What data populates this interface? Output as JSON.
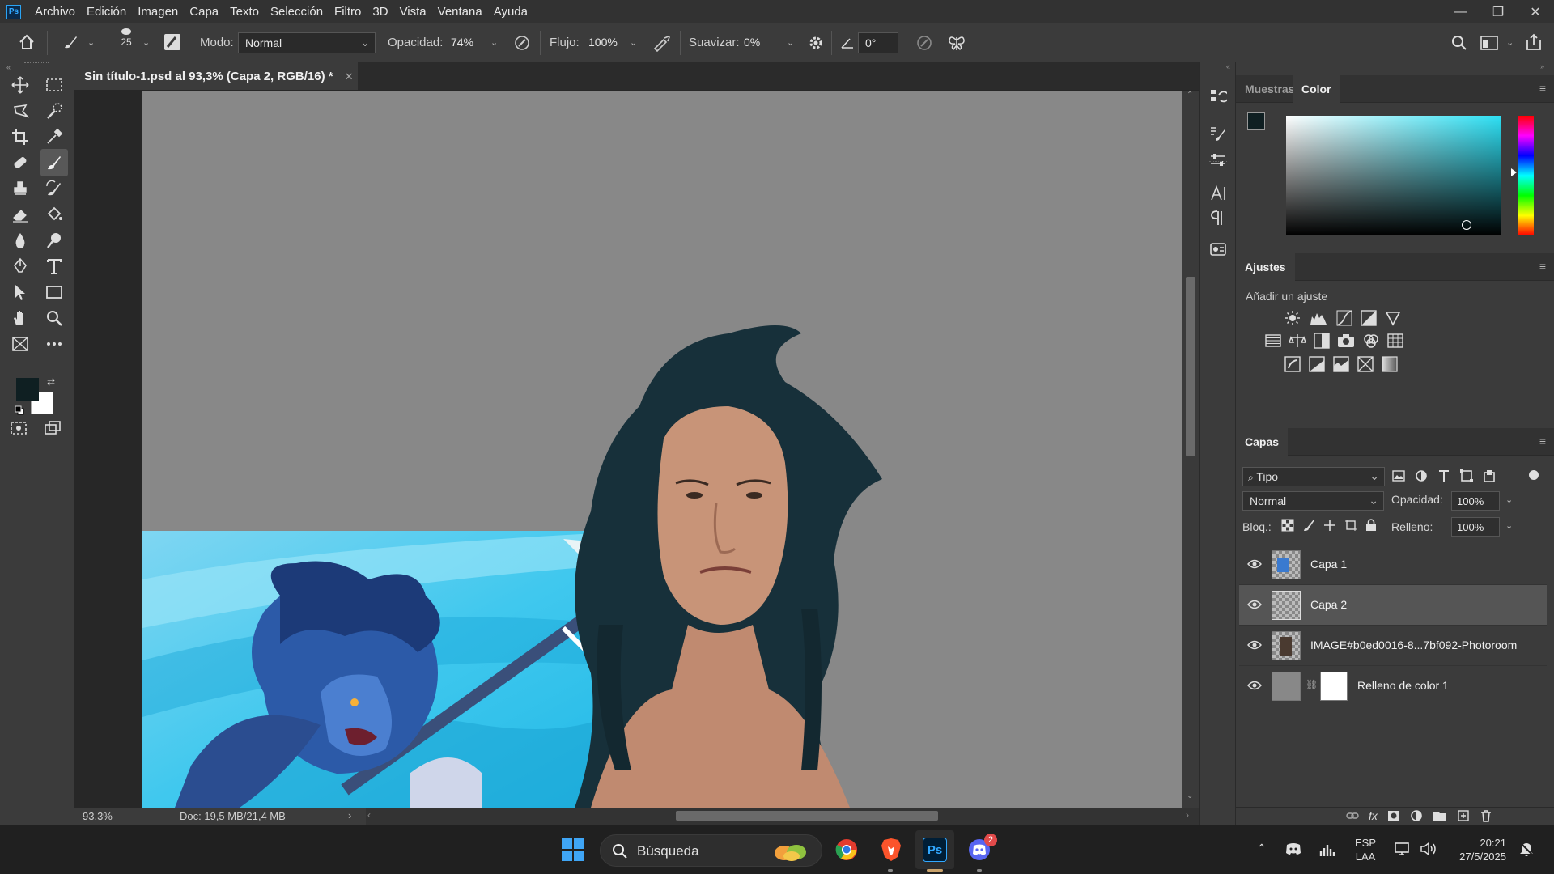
{
  "app": {
    "logo": "Ps"
  },
  "menu": [
    "Archivo",
    "Edición",
    "Imagen",
    "Capa",
    "Texto",
    "Selección",
    "Filtro",
    "3D",
    "Vista",
    "Ventana",
    "Ayuda"
  ],
  "window_controls": {
    "minimize": "—",
    "restore": "❐",
    "close": "✕"
  },
  "options": {
    "brush_size": "25",
    "mode_label": "Modo:",
    "mode_value": "Normal",
    "opacity_label": "Opacidad:",
    "opacity_value": "74%",
    "flow_label": "Flujo:",
    "flow_value": "100%",
    "smooth_label": "Suavizar:",
    "smooth_value": "0%",
    "angle_value": "0°"
  },
  "document": {
    "tab_title": "Sin título-1.psd al 93,3% (Capa 2, RGB/16) *",
    "zoom": "93,3%",
    "doc_info": "Doc: 19,5 MB/21,4 MB"
  },
  "colors": {
    "foreground": "#0f1f22",
    "background": "#ffffff",
    "accent": "#31a8ff"
  },
  "panels": {
    "swatches_tab": "Muestras",
    "color_tab": "Color",
    "adjustments_tab": "Ajustes",
    "add_adjustment": "Añadir un ajuste",
    "layers_tab": "Capas"
  },
  "layers_panel": {
    "filter_kind": "Tipo",
    "blend_mode": "Normal",
    "opacity_label": "Opacidad:",
    "opacity_value": "100%",
    "lock_label": "Bloq.:",
    "fill_label": "Relleno:",
    "fill_value": "100%",
    "layers": [
      {
        "name": "Capa 1",
        "visible": true,
        "selected": false
      },
      {
        "name": "Capa 2",
        "visible": true,
        "selected": true
      },
      {
        "name": "IMAGE#b0ed0016-8...7bf092-Photoroom",
        "visible": true,
        "selected": false
      },
      {
        "name": "Relleno de color 1",
        "visible": true,
        "selected": false
      }
    ]
  },
  "taskbar": {
    "search_placeholder": "Búsqueda",
    "lang_line1": "ESP",
    "lang_line2": "LAA",
    "time": "20:21",
    "date": "27/5/2025",
    "discord_badge": "2"
  }
}
